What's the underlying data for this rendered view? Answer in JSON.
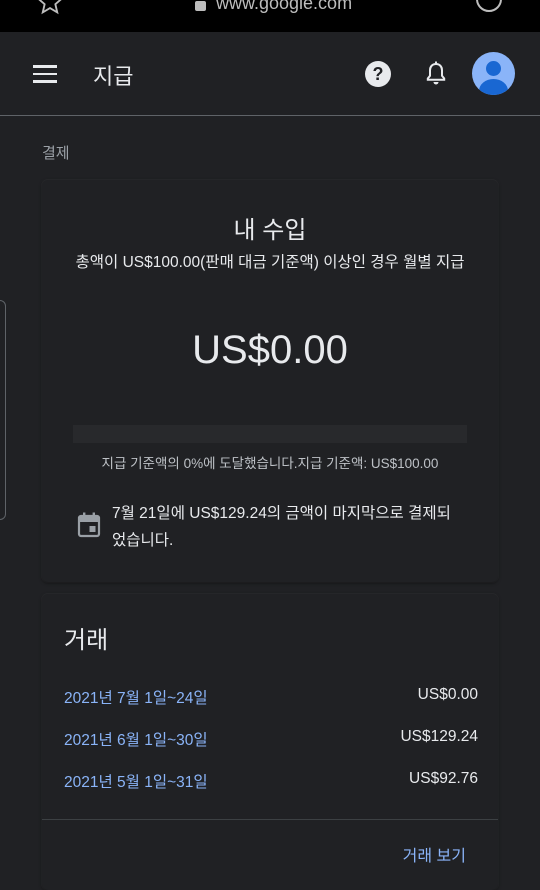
{
  "browser": {
    "url": "www.google.com"
  },
  "appbar": {
    "title": "지급"
  },
  "breadcrumb": "결제",
  "earnings": {
    "title": "내 수입",
    "subtitle": "총액이 US$100.00(판매 대금 기준액) 이상인 경우 월별 지급",
    "amount": "US$0.00",
    "progress_percent": 0,
    "threshold_text": "지급 기준액의 0%에 도달했습니다.지급 기준액: US$100.00",
    "last_payment": "7월 21일에 US$129.24의 금액이 마지막으로 결제되었습니다."
  },
  "transactions": {
    "title": "거래",
    "rows": [
      {
        "period": "2021년 7월 1일~24일",
        "amount": "US$0.00"
      },
      {
        "period": "2021년 6월 1일~30일",
        "amount": "US$129.24"
      },
      {
        "period": "2021년 5월 1일~31일",
        "amount": "US$92.76"
      }
    ],
    "view_label": "거래 보기"
  },
  "icons": {
    "menu": "menu-icon",
    "help": "help-icon",
    "notifications": "bell-icon",
    "avatar": "avatar",
    "calendar": "calendar-icon",
    "star": "star-icon",
    "lock": "lock-icon"
  },
  "colors": {
    "background": "#202124",
    "link": "#8ab4f8",
    "text": "#e8eaed",
    "muted": "#9aa0a6"
  }
}
